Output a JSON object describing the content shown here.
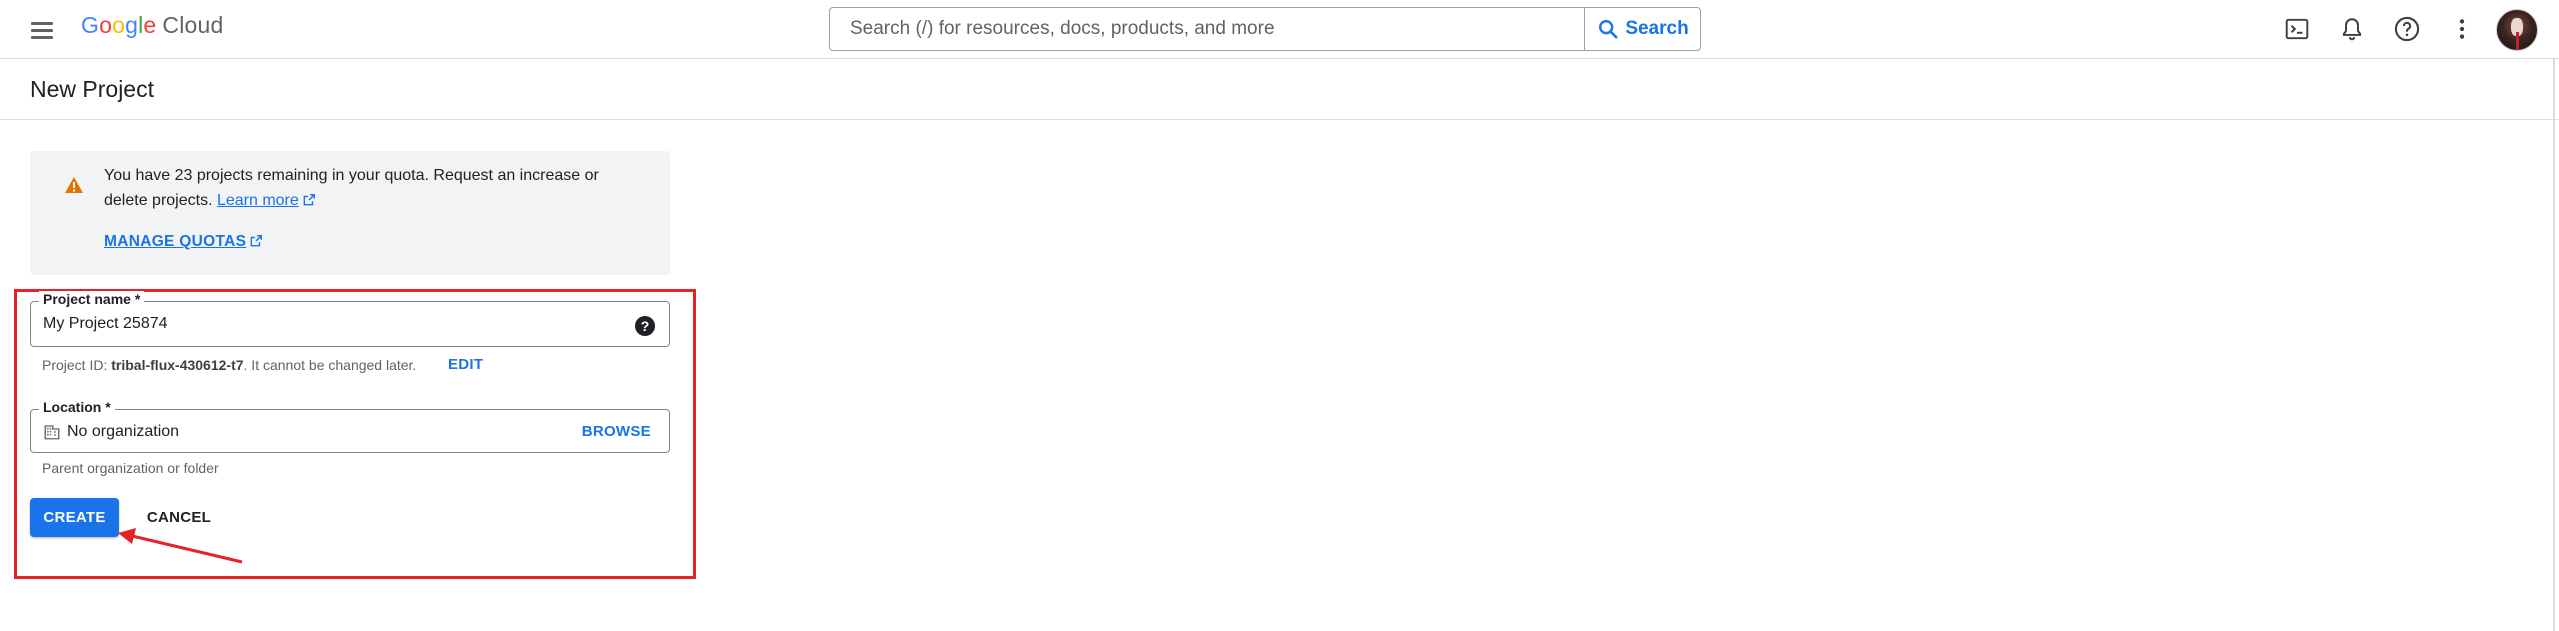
{
  "header": {
    "logo": {
      "g1": "G",
      "o1": "o",
      "o2": "o",
      "g2": "g",
      "l": "l",
      "e": "e",
      "product": "Cloud"
    },
    "search": {
      "placeholder": "Search (/) for resources, docs, products, and more",
      "button_label": "Search"
    },
    "icons": [
      "menu-icon",
      "terminal-icon",
      "bell-icon",
      "help-circle-icon",
      "more-vert-icon",
      "avatar"
    ]
  },
  "page": {
    "title": "New Project"
  },
  "notice": {
    "text_before": "You have 23 projects remaining in your quota. Request an increase or delete projects. ",
    "learn_more": "Learn more",
    "manage_quotas": "MANAGE QUOTAS"
  },
  "form": {
    "project_name": {
      "label": "Project name *",
      "value": "My Project 25874"
    },
    "project_id": {
      "prefix": "Project ID: ",
      "id": "tribal-flux-430612-t7",
      "suffix": ". It cannot be changed later.",
      "edit": "EDIT"
    },
    "location": {
      "label": "Location *",
      "value": "No organization",
      "browse": "BROWSE",
      "hint": "Parent organization or folder"
    },
    "create_label": "CREATE",
    "cancel_label": "CANCEL"
  },
  "colors": {
    "accent": "#1a73e8",
    "highlight": "#e5222a",
    "warning": "#e37400"
  }
}
